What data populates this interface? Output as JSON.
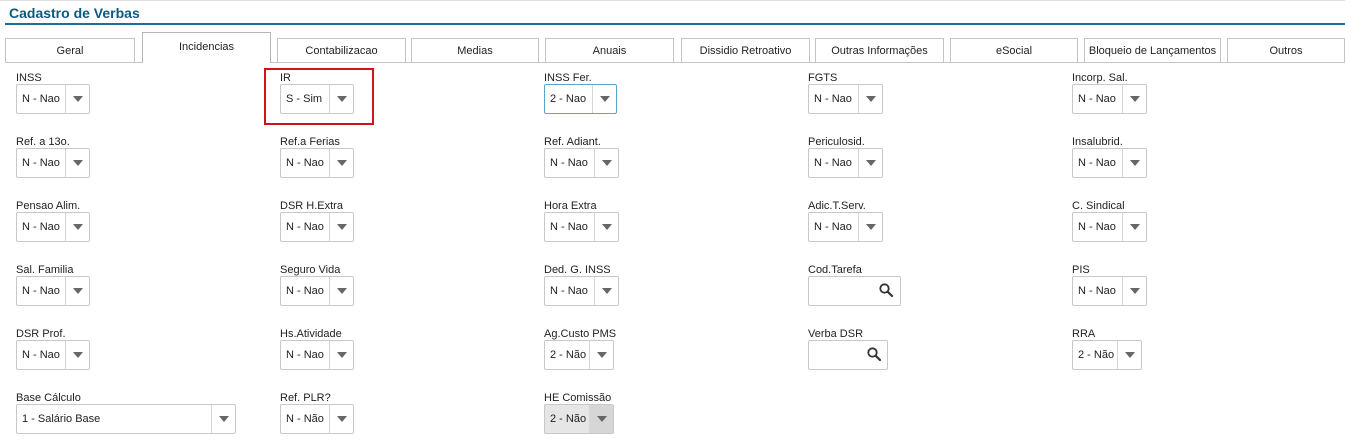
{
  "page": {
    "title": "Cadastro de Verbas"
  },
  "tabs": [
    {
      "label": "Geral",
      "active": false
    },
    {
      "label": "Incidencias",
      "active": true
    },
    {
      "label": "Contabilizacao",
      "active": false
    },
    {
      "label": "Medias",
      "active": false
    },
    {
      "label": "Anuais",
      "active": false
    },
    {
      "label": "Dissidio Retroativo",
      "active": false
    },
    {
      "label": "Outras Informações",
      "active": false
    },
    {
      "label": "eSocial",
      "active": false
    },
    {
      "label": "Bloqueio de Lançamentos",
      "active": false
    },
    {
      "label": "Outros",
      "active": false
    }
  ],
  "fields": {
    "inss": {
      "label": "INSS",
      "value": "N - Nao"
    },
    "ir": {
      "label": "IR",
      "value": "S - Sim"
    },
    "inss_fer": {
      "label": "INSS Fer.",
      "value": "2 - Nao"
    },
    "fgts": {
      "label": "FGTS",
      "value": "N - Nao"
    },
    "incorp_sal": {
      "label": "Incorp. Sal.",
      "value": "N - Nao"
    },
    "ref_13o": {
      "label": "Ref. a 13o.",
      "value": "N - Nao"
    },
    "ref_ferias": {
      "label": "Ref.a Ferias",
      "value": "N - Nao"
    },
    "ref_adiant": {
      "label": "Ref. Adiant.",
      "value": "N - Nao"
    },
    "periculosid": {
      "label": "Periculosid.",
      "value": "N - Nao"
    },
    "insalubrid": {
      "label": "Insalubrid.",
      "value": "N - Nao"
    },
    "pensao_alim": {
      "label": "Pensao Alim.",
      "value": "N - Nao"
    },
    "dsr_hextra": {
      "label": "DSR H.Extra",
      "value": "N - Nao"
    },
    "hora_extra": {
      "label": "Hora Extra",
      "value": "N - Nao"
    },
    "adic_tserv": {
      "label": "Adic.T.Serv.",
      "value": "N - Nao"
    },
    "c_sindical": {
      "label": "C. Sindical",
      "value": "N - Nao"
    },
    "sal_familia": {
      "label": "Sal. Familia",
      "value": "N - Nao"
    },
    "seguro_vida": {
      "label": "Seguro Vida",
      "value": "N - Nao"
    },
    "ded_g_inss": {
      "label": "Ded. G. INSS",
      "value": "N - Nao"
    },
    "cod_tarefa": {
      "label": "Cod.Tarefa",
      "value": ""
    },
    "pis": {
      "label": "PIS",
      "value": "N - Nao"
    },
    "dsr_prof": {
      "label": "DSR Prof.",
      "value": "N - Nao"
    },
    "hs_atividade": {
      "label": "Hs.Atividade",
      "value": "N - Nao"
    },
    "ag_custo_pms": {
      "label": "Ag.Custo PMS",
      "value": "2 - Não"
    },
    "verba_dsr": {
      "label": "Verba DSR",
      "value": ""
    },
    "rra": {
      "label": "RRA",
      "value": "2 - Não"
    },
    "base_calculo": {
      "label": "Base Cálculo",
      "value": "1 - Salário Base"
    },
    "ref_plr": {
      "label": "Ref. PLR?",
      "value": "N - Não"
    },
    "he_comissao": {
      "label": "HE Comissão",
      "value": "2 - Não"
    }
  },
  "colors": {
    "title": "#0b5a82",
    "highlight": "#d0141c",
    "focus": "#5aa6c9"
  },
  "icons": {
    "dropdown": "chevron-down-icon",
    "search": "search-icon"
  }
}
